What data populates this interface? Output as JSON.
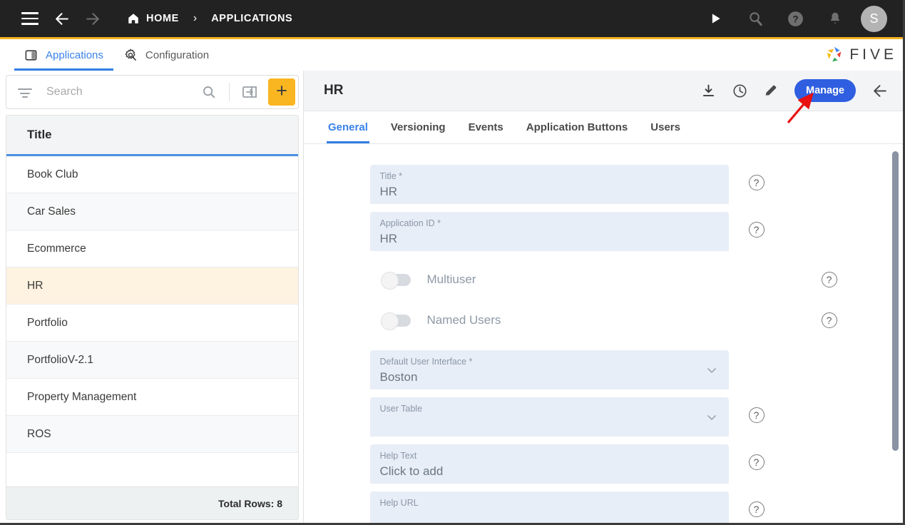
{
  "topbar": {
    "menu_icon": "hamburger-icon",
    "back_icon": "arrow-left-icon",
    "forward_icon": "arrow-right-icon",
    "home_icon": "home-icon",
    "breadcrumbs": [
      {
        "label": "HOME",
        "icon": "home-icon"
      },
      {
        "label": "APPLICATIONS",
        "icon": ""
      }
    ],
    "separator": "›",
    "actions": [
      {
        "name": "run-icon",
        "glyph": "▶"
      },
      {
        "name": "search-magnifier-icon",
        "glyph": ""
      },
      {
        "name": "help-circle-icon",
        "glyph": "?"
      },
      {
        "name": "notifications-bell-icon",
        "glyph": ""
      }
    ],
    "avatar_initial": "S",
    "accent_bar_color": "#f5b324",
    "background": "#222222"
  },
  "tabstrip": {
    "tabs": [
      {
        "label": "Applications",
        "icon": "book-panel-icon",
        "active": true
      },
      {
        "label": "Configuration",
        "icon": "gear-wrench-icon",
        "active": false
      }
    ],
    "brand": {
      "text": "FIVE",
      "icon": "five-logo-icon"
    },
    "active_color": "#3b82e8"
  },
  "sidebar": {
    "filter_icon": "filter-icon",
    "search": {
      "placeholder": "Search",
      "value": ""
    },
    "search_icon": "search-icon",
    "import_icon": "import-arrow-icon",
    "add_button": {
      "label": "+",
      "name": "add-record-button",
      "color": "#f9b621"
    },
    "grid": {
      "column_header": "Title",
      "rows": [
        {
          "title": "Book Club",
          "selected": false
        },
        {
          "title": "Car Sales",
          "selected": false
        },
        {
          "title": "Ecommerce",
          "selected": false
        },
        {
          "title": "HR",
          "selected": true
        },
        {
          "title": "Portfolio",
          "selected": false
        },
        {
          "title": "PortfolioV-2.1",
          "selected": false
        },
        {
          "title": "Property Management",
          "selected": false
        },
        {
          "title": "ROS",
          "selected": false
        }
      ],
      "footer": "Total Rows: 8",
      "selected_row_color": "#fdf3e0",
      "header_underline_color": "#4a90e2"
    }
  },
  "main": {
    "title": "HR",
    "header_actions": [
      {
        "name": "download-icon",
        "label": "Download"
      },
      {
        "name": "history-clock-icon",
        "label": "History"
      },
      {
        "name": "edit-pencil-icon",
        "label": "Edit"
      }
    ],
    "manage_button": {
      "label": "Manage",
      "color": "#2f5fe0"
    },
    "close_icon": "arrow-left-icon",
    "tabs": [
      {
        "label": "General",
        "active": true
      },
      {
        "label": "Versioning",
        "active": false
      },
      {
        "label": "Events",
        "active": false
      },
      {
        "label": "Application Buttons",
        "active": false
      },
      {
        "label": "Users",
        "active": false
      }
    ],
    "form": {
      "fields": [
        {
          "type": "text",
          "label": "Title *",
          "value": "HR",
          "help": true,
          "chevron": false
        },
        {
          "type": "text",
          "label": "Application ID *",
          "value": "HR",
          "help": true,
          "chevron": false
        },
        {
          "type": "toggle",
          "label": "Multiuser",
          "on": false,
          "help": true
        },
        {
          "type": "toggle",
          "label": "Named Users",
          "on": false,
          "help": true
        },
        {
          "type": "select",
          "label": "Default User Interface *",
          "value": "Boston",
          "help": false,
          "chevron": true
        },
        {
          "type": "select",
          "label": "User Table",
          "value": "",
          "help": true,
          "chevron": true
        },
        {
          "type": "text",
          "label": "Help Text",
          "value": "Click to add",
          "help": true,
          "chevron": false
        },
        {
          "type": "text",
          "label": "Help URL",
          "value": "",
          "help": true,
          "chevron": false
        }
      ],
      "field_background": "#e8eef7"
    },
    "scrollbar": {
      "name": "vertical-scrollbar"
    }
  },
  "annotation": {
    "arrow_color": "#e81010",
    "points_to": "manage-button"
  }
}
